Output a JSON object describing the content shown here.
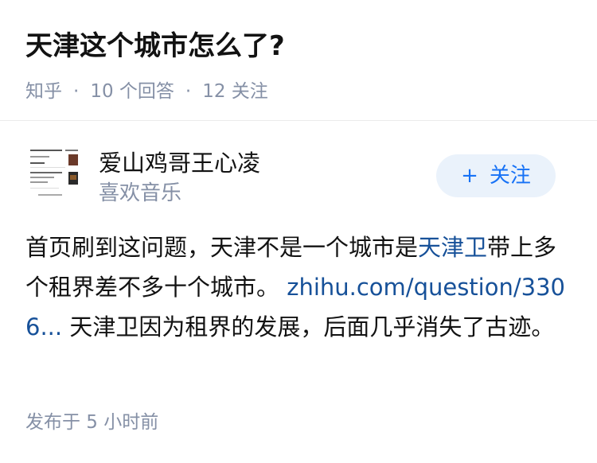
{
  "question": {
    "title": "天津这个城市怎么了?",
    "source": "知乎",
    "answers": "10 个回答",
    "followers": "12 关注"
  },
  "author": {
    "name": "爱山鸡哥王心凌",
    "bio": "喜欢音乐",
    "follow_label": "关注",
    "follow_icon": "plus-icon"
  },
  "answer": {
    "text_part1": "首页刷到这问题，天津不是一个城市是",
    "highlight": "天津卫",
    "text_part2": "带上多个租界差不多十个城市。 ",
    "link_text": "zhihu.com/question/3306...",
    "text_part3": " 天津卫因为租界的发展，后面几乎消失了古迹。"
  },
  "footer": {
    "published": "发布于  5 小时前"
  },
  "colors": {
    "link": "#175199",
    "accent": "#1772f6",
    "meta": "#8590a6",
    "follow_bg": "#eaf2fb"
  }
}
